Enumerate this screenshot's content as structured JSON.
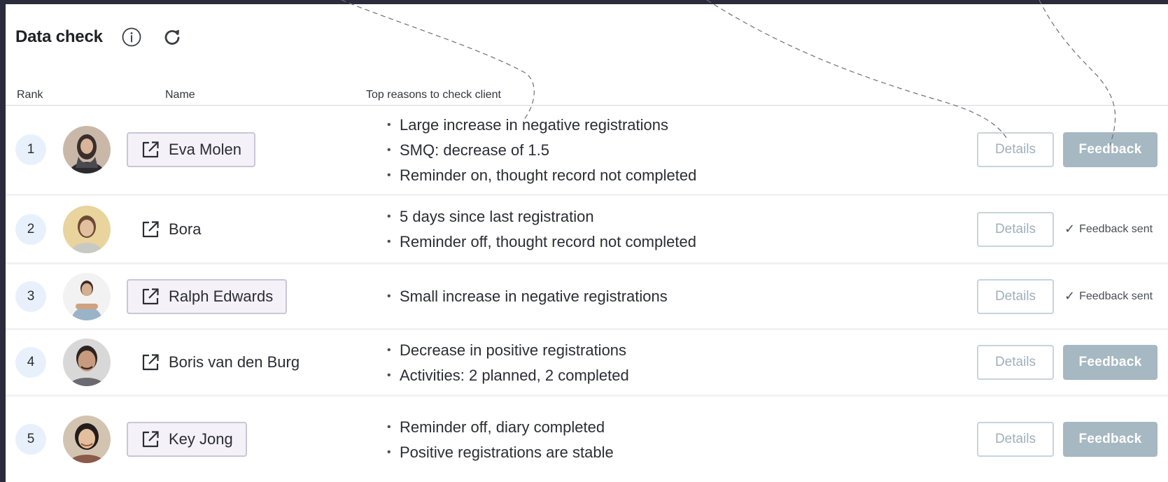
{
  "header": {
    "title": "Data check",
    "info_icon": "info-icon",
    "refresh_icon": "refresh-icon"
  },
  "columns": {
    "rank": "Rank",
    "name": "Name",
    "reasons": "Top reasons to check client"
  },
  "colors": {
    "rank_bg": "#e8f1fb",
    "details_border": "#c7d4da",
    "feedback_bg": "#a6b8c1",
    "name_box_bg": "#f4f2f8"
  },
  "rows": [
    {
      "rank": "1",
      "name": "Eva Molen",
      "reasons": [
        "Large increase in negative registrations",
        "SMQ: decrease of 1.5",
        "Reminder on, thought record not completed"
      ],
      "details_label": "Details",
      "feedback_label": "Feedback",
      "feedback_sent": false
    },
    {
      "rank": "2",
      "name": "Bora",
      "reasons": [
        "5 days since last registration",
        "Reminder off, thought record not completed"
      ],
      "details_label": "Details",
      "feedback_sent_label": "Feedback sent",
      "feedback_sent": true
    },
    {
      "rank": "3",
      "name": "Ralph Edwards",
      "reasons": [
        "Small increase in negative registrations"
      ],
      "details_label": "Details",
      "feedback_sent_label": "Feedback sent",
      "feedback_sent": true
    },
    {
      "rank": "4",
      "name": "Boris van den Burg",
      "reasons": [
        "Decrease in positive registrations",
        "Activities: 2 planned, 2 completed"
      ],
      "details_label": "Details",
      "feedback_label": "Feedback",
      "feedback_sent": false
    },
    {
      "rank": "5",
      "name": "Key Jong",
      "reasons": [
        "Reminder off, diary completed",
        "Positive registrations are stable"
      ],
      "details_label": "Details",
      "feedback_label": "Feedback",
      "feedback_sent": false
    }
  ],
  "icons": {
    "external_link": "external-link-icon",
    "check": "✓",
    "bullet": "•"
  }
}
